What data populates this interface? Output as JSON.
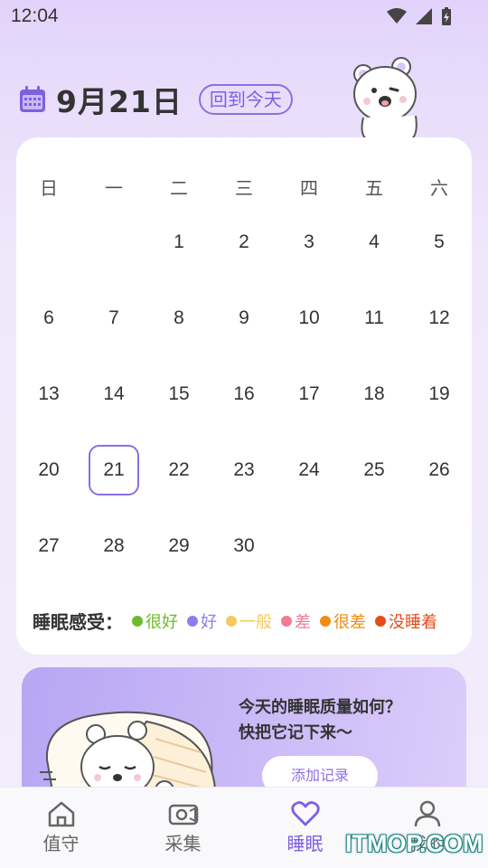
{
  "status_bar": {
    "time": "12:04"
  },
  "header": {
    "date": "9月21日",
    "today_button": "回到今天"
  },
  "calendar": {
    "weekdays": [
      "日",
      "一",
      "二",
      "三",
      "四",
      "五",
      "六"
    ],
    "weeks": [
      [
        "",
        "",
        "1",
        "2",
        "3",
        "4",
        "5"
      ],
      [
        "6",
        "7",
        "8",
        "9",
        "10",
        "11",
        "12"
      ],
      [
        "13",
        "14",
        "15",
        "16",
        "17",
        "18",
        "19"
      ],
      [
        "20",
        "21",
        "22",
        "23",
        "24",
        "25",
        "26"
      ],
      [
        "27",
        "28",
        "29",
        "30",
        "",
        "",
        ""
      ]
    ],
    "selected_day": "21",
    "accent_color": "#8c6ee4"
  },
  "legend": {
    "title": "睡眠感受：",
    "items": [
      {
        "label": "很好",
        "color": "#6fba2c"
      },
      {
        "label": "好",
        "color": "#8a7ef0"
      },
      {
        "label": "一般",
        "color": "#f5c95a"
      },
      {
        "label": "差",
        "color": "#ef7c93"
      },
      {
        "label": "很差",
        "color": "#f08c10"
      },
      {
        "label": "没睡着",
        "color": "#e84a18"
      }
    ]
  },
  "promo": {
    "line1": "今天的睡眠质量如何？",
    "line2": "快把它记下来～",
    "button": "添加记录"
  },
  "bottom_nav": {
    "items": [
      {
        "label": "值守",
        "icon": "home-icon"
      },
      {
        "label": "采集",
        "icon": "camera-icon"
      },
      {
        "label": "睡眠",
        "icon": "heart-icon",
        "active": true
      },
      {
        "label": "我的",
        "icon": "user-icon"
      }
    ]
  },
  "watermark": "ITMOP.COM"
}
